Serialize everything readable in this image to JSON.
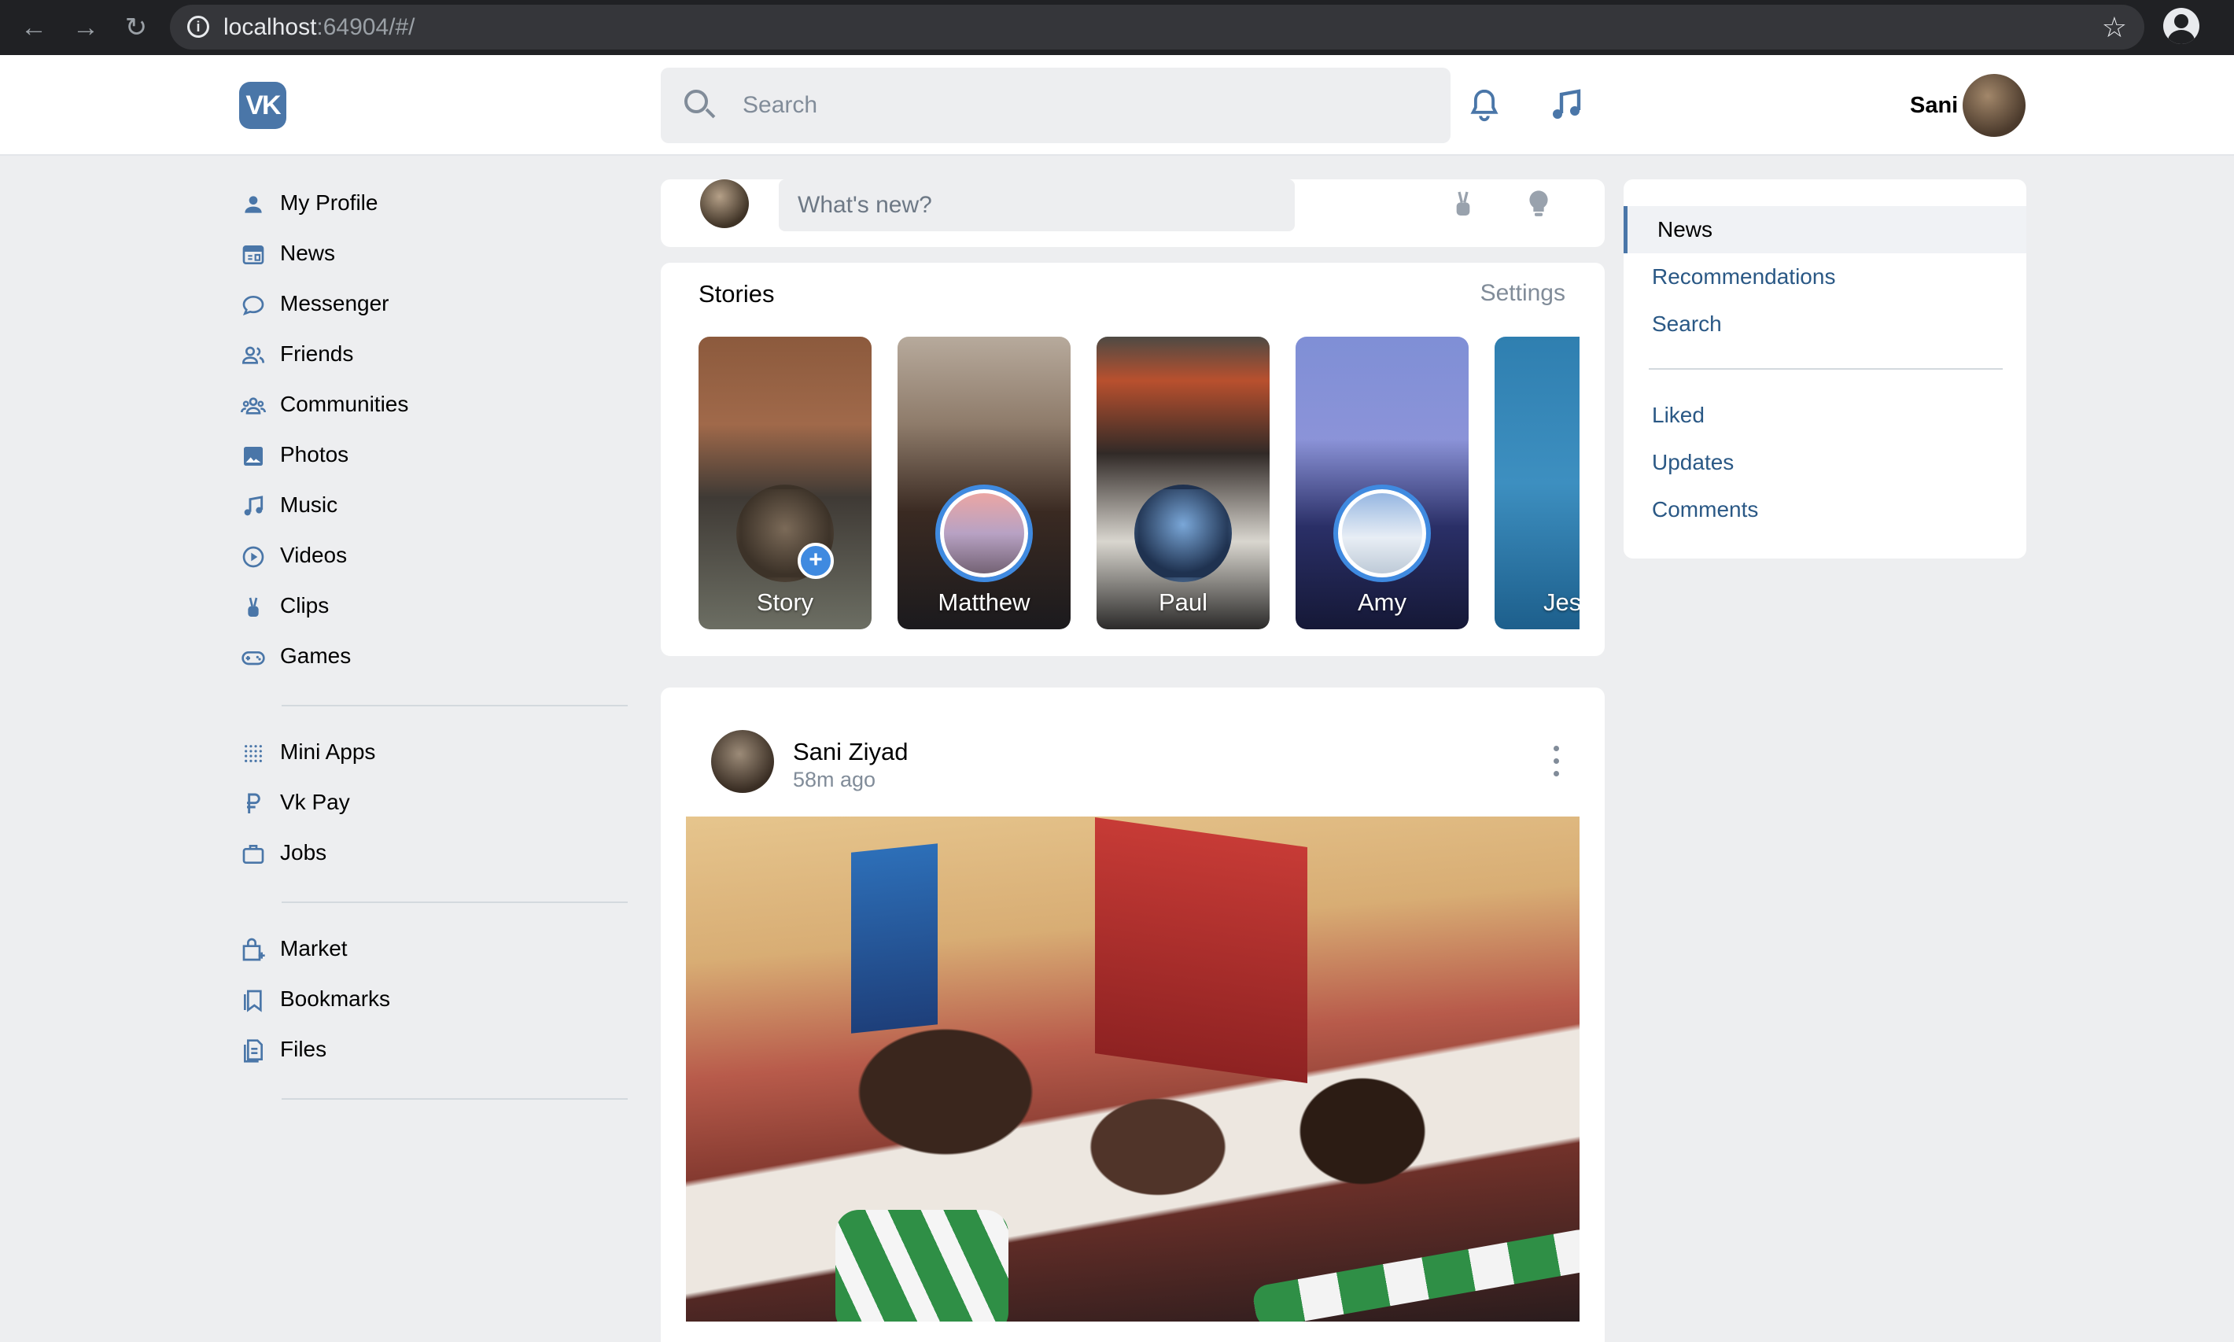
{
  "browser": {
    "url_host": "localhost",
    "url_rest": ":64904/#/"
  },
  "header": {
    "logo": "VK",
    "search_placeholder": "Search",
    "user_name": "Sani"
  },
  "left_nav": {
    "group1": [
      {
        "label": "My Profile",
        "icon": "person-icon"
      },
      {
        "label": "News",
        "icon": "newspaper-icon"
      },
      {
        "label": "Messenger",
        "icon": "chat-bubble-icon"
      },
      {
        "label": "Friends",
        "icon": "friends-icon"
      },
      {
        "label": "Communities",
        "icon": "communities-icon"
      },
      {
        "label": "Photos",
        "icon": "photo-icon"
      },
      {
        "label": "Music",
        "icon": "music-note-icon"
      },
      {
        "label": "Videos",
        "icon": "play-circle-icon"
      },
      {
        "label": "Clips",
        "icon": "clips-icon"
      },
      {
        "label": "Games",
        "icon": "gamepad-icon"
      }
    ],
    "group2": [
      {
        "label": "Mini Apps",
        "icon": "apps-grid-icon"
      },
      {
        "label": "Vk Pay",
        "icon": "ruble-icon"
      },
      {
        "label": "Jobs",
        "icon": "briefcase-icon"
      }
    ],
    "group3": [
      {
        "label": "Market",
        "icon": "market-bag-icon"
      },
      {
        "label": "Bookmarks",
        "icon": "bookmark-icon"
      },
      {
        "label": "Files",
        "icon": "file-icon"
      }
    ]
  },
  "composer": {
    "placeholder": "What's new?"
  },
  "stories": {
    "title": "Stories",
    "settings_label": "Settings",
    "items": [
      {
        "name": "Story"
      },
      {
        "name": "Matthew"
      },
      {
        "name": "Paul"
      },
      {
        "name": "Amy"
      },
      {
        "name": "Jessica"
      }
    ]
  },
  "post": {
    "author": "Sani Ziyad",
    "time": "58m ago"
  },
  "right_menu": {
    "items": [
      {
        "label": "News",
        "active": true
      },
      {
        "label": "Recommendations"
      },
      {
        "label": "Search"
      }
    ],
    "items2": [
      {
        "label": "Liked"
      },
      {
        "label": "Updates"
      },
      {
        "label": "Comments"
      }
    ]
  },
  "colors": {
    "accent": "#4a76a8",
    "link": "#2a5885",
    "story_ring": "#3f8ae0",
    "page_bg": "#edeef0"
  }
}
